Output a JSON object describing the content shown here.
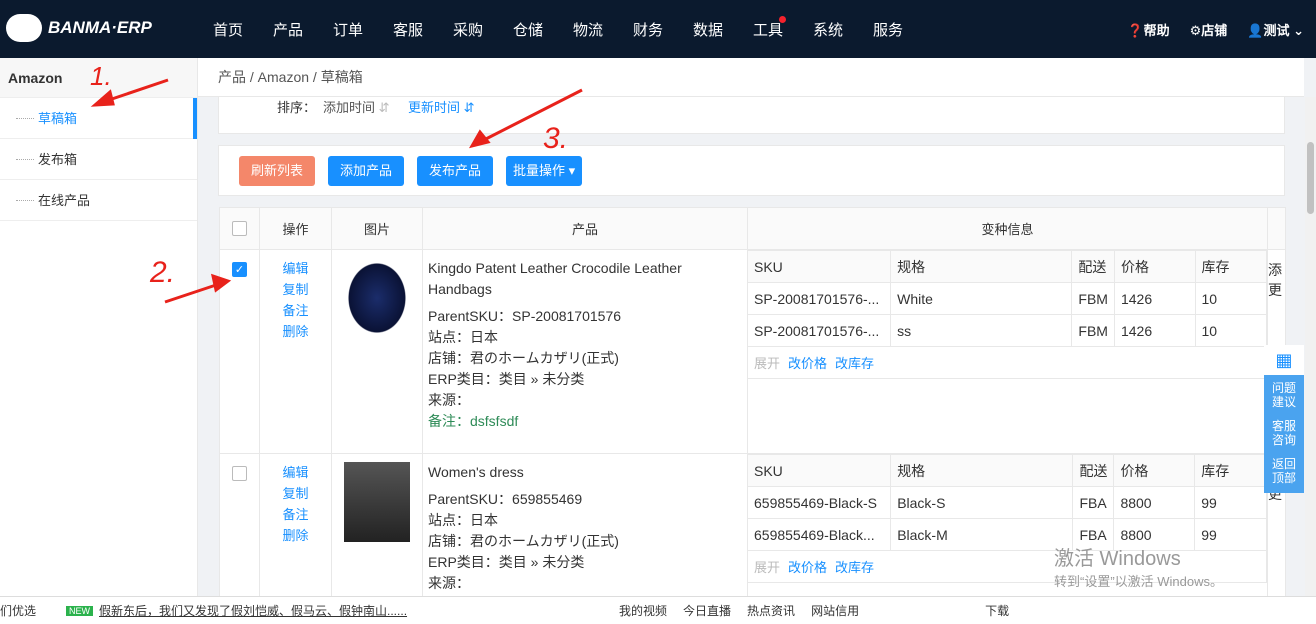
{
  "header": {
    "logo": "BANMA·ERP",
    "nav": [
      "首页",
      "产品",
      "订单",
      "客服",
      "采购",
      "仓储",
      "物流",
      "财务",
      "数据",
      "工具",
      "系统",
      "服务"
    ],
    "help": "帮助",
    "shop": "店铺",
    "user": "测试"
  },
  "sidebar": {
    "title": "Amazon",
    "items": [
      "草稿箱",
      "发布箱",
      "在线产品"
    ]
  },
  "breadcrumb": "产品 / Amazon / 草稿箱",
  "sort": {
    "label": "排序：",
    "opt1": "添加时间",
    "opt2": "更新时间"
  },
  "toolbar": {
    "refresh": "刷新列表",
    "add": "添加产品",
    "publish": "发布产品",
    "batch": "批量操作 ▾"
  },
  "table": {
    "headers": [
      "操作",
      "图片",
      "产品",
      "变种信息"
    ],
    "sub_headers": [
      "SKU",
      "规格",
      "配送",
      "价格",
      "库存"
    ],
    "ops": [
      "编辑",
      "复制",
      "备注",
      "删除"
    ],
    "variant_links": [
      "展开",
      "改价格",
      "改库存"
    ],
    "extra": [
      "添",
      "更"
    ],
    "rows": [
      {
        "checked": true,
        "title": "Kingdo Patent Leather Crocodile Leather Handbags",
        "parent_sku": "ParentSKU：SP-20081701576",
        "site": "站点：日本",
        "shop": "店铺：君のホームカザリ(正式)",
        "category": "ERP类目：类目 » 未分类",
        "source": "来源：",
        "note": "备注：dsfsfsdf",
        "variants": [
          [
            "SP-20081701576-...",
            "White",
            "FBM",
            "1426",
            "10"
          ],
          [
            "SP-20081701576-...",
            "ss",
            "FBM",
            "1426",
            "10"
          ]
        ]
      },
      {
        "checked": false,
        "title": "Women's dress",
        "parent_sku": "ParentSKU：659855469",
        "site": "站点：日本",
        "shop": "店铺：君のホームカザリ(正式)",
        "category": "ERP类目：类目 » 未分类",
        "source": "来源：",
        "variants": [
          [
            "659855469-Black-S",
            "Black-S",
            "FBA",
            "8800",
            "99"
          ],
          [
            "659855469-Black...",
            "Black-M",
            "FBA",
            "8800",
            "99"
          ]
        ]
      }
    ]
  },
  "float_panel": {
    "b1": "问题建议",
    "b2": "客服咨询",
    "b3": "返回顶部"
  },
  "annotations": [
    "1.",
    "2.",
    "3."
  ],
  "watermark": {
    "title": "激活 Windows",
    "sub": "转到“设置”以激活 Windows。"
  },
  "taskbar": {
    "left": "们优选",
    "news": "假新东后，我们又发现了假刘恺威、假马云、假钟南山......",
    "items": [
      "我的视频",
      "今日直播",
      "热点资讯",
      "网站信用",
      "下载"
    ]
  },
  "colors": {
    "nav_bg": "#0b1a2e",
    "primary": "#1890ff",
    "refresh": "#f4876a",
    "arrow": "#e8221b"
  }
}
